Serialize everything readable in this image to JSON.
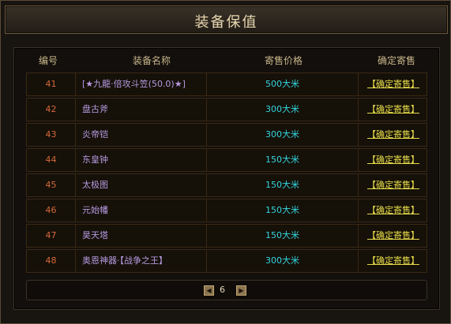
{
  "window": {
    "title": "装备保值"
  },
  "table": {
    "headers": [
      "编号",
      "装备名称",
      "寄售价格",
      "确定寄售"
    ],
    "rows": [
      {
        "id": "41",
        "name": "[★九龍·倍攻斗笠(50.0)★]",
        "price": "500大米",
        "action": "【确定寄售】"
      },
      {
        "id": "42",
        "name": "盘古斧",
        "price": "300大米",
        "action": "【确定寄售】"
      },
      {
        "id": "43",
        "name": "炎帝铠",
        "price": "300大米",
        "action": "【确定寄售】"
      },
      {
        "id": "44",
        "name": "东皇钟",
        "price": "150大米",
        "action": "【确定寄售】"
      },
      {
        "id": "45",
        "name": "太极图",
        "price": "150大米",
        "action": "【确定寄售】"
      },
      {
        "id": "46",
        "name": "元始幡",
        "price": "150大米",
        "action": "【确定寄售】"
      },
      {
        "id": "47",
        "name": "昊天塔",
        "price": "150大米",
        "action": "【确定寄售】"
      },
      {
        "id": "48",
        "name": "奥恩神器·【战争之王】",
        "price": "300大米",
        "action": "【确定寄售】"
      }
    ]
  },
  "pager": {
    "page": "6",
    "prev_icon": "arrow-left-icon",
    "next_icon": "arrow-right-icon"
  },
  "colors": {
    "id": "#d66a3a",
    "name": "#b69ae0",
    "price": "#33d6df",
    "action": "#e6dc4a",
    "title": "#e8d7b0"
  }
}
